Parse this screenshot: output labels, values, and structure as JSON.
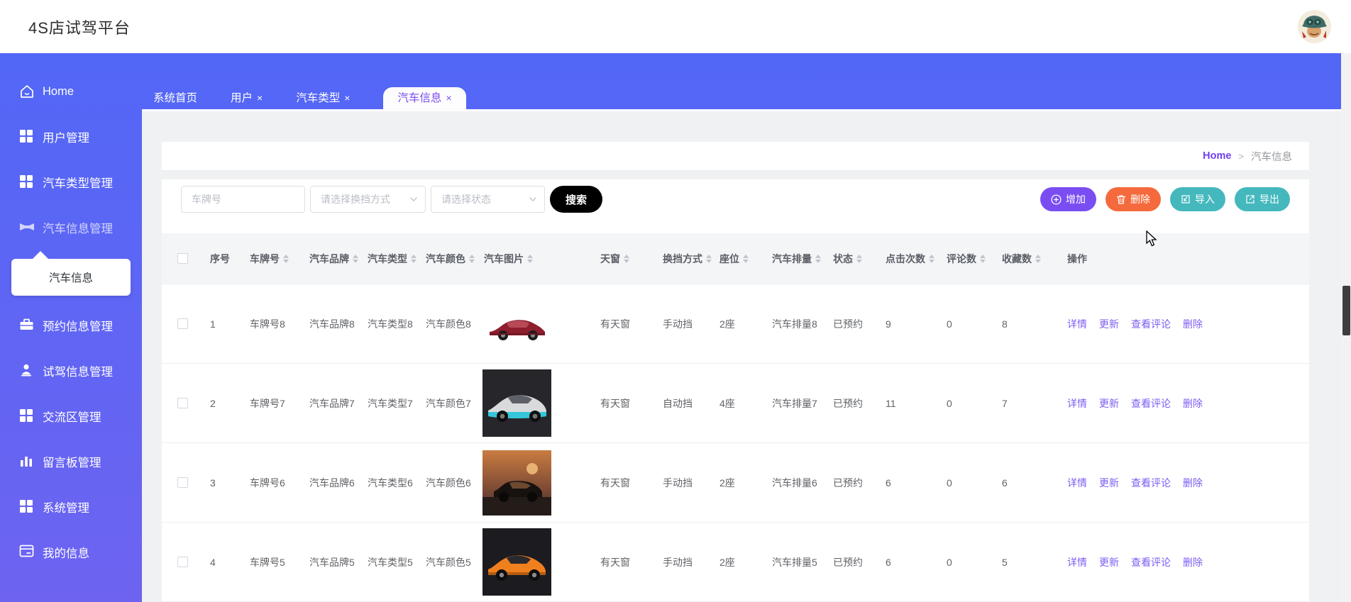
{
  "app": {
    "title": "4S店试驾平台"
  },
  "sidebar": {
    "items": [
      {
        "label": "Home",
        "icon": "home-icon",
        "active": false
      },
      {
        "label": "用户管理",
        "icon": "grid-icon",
        "active": false
      },
      {
        "label": "汽车类型管理",
        "icon": "grid-icon",
        "active": false
      },
      {
        "label": "汽车信息管理",
        "icon": "car-icon",
        "active": true
      },
      {
        "label": "预约信息管理",
        "icon": "briefcase-icon",
        "active": false
      },
      {
        "label": "试驾信息管理",
        "icon": "user-icon",
        "active": false
      },
      {
        "label": "交流区管理",
        "icon": "grid-icon",
        "active": false
      },
      {
        "label": "留言板管理",
        "icon": "bar-chart-icon",
        "active": false
      },
      {
        "label": "系统管理",
        "icon": "grid-icon",
        "active": false
      },
      {
        "label": "我的信息",
        "icon": "card-icon",
        "active": false
      }
    ],
    "submenu": {
      "label": "汽车信息"
    }
  },
  "tabs": [
    {
      "label": "系统首页",
      "closable": false,
      "active": false
    },
    {
      "label": "用户",
      "closable": true,
      "active": false
    },
    {
      "label": "汽车类型",
      "closable": true,
      "active": false
    },
    {
      "label": "汽车信息",
      "closable": true,
      "active": true
    }
  ],
  "breadcrumb": {
    "home": "Home",
    "separator": ">",
    "current": "汽车信息"
  },
  "search": {
    "plate_placeholder": "车牌号",
    "gear_placeholder": "请选择换挡方式",
    "status_placeholder": "请选择状态",
    "button": "搜索"
  },
  "actions": {
    "add": "增加",
    "delete": "删除",
    "import": "导入",
    "export": "导出"
  },
  "table": {
    "headers": [
      "序号",
      "车牌号",
      "汽车品牌",
      "汽车类型",
      "汽车颜色",
      "汽车图片",
      "天窗",
      "换挡方式",
      "座位",
      "汽车排量",
      "状态",
      "点击次数",
      "评论数",
      "收藏数",
      "操作"
    ],
    "row_actions": [
      "详情",
      "更新",
      "查看评论",
      "删除"
    ],
    "rows": [
      {
        "index": "1",
        "plate": "车牌号8",
        "brand": "汽车品牌8",
        "type": "汽车类型8",
        "color": "汽车颜色8",
        "image": "red-sedan",
        "sunroof": "有天窗",
        "gear": "手动挡",
        "seats": "2座",
        "displacement": "汽车排量8",
        "status": "已预约",
        "clicks": "9",
        "comments": "0",
        "favorites": "8"
      },
      {
        "index": "2",
        "plate": "车牌号7",
        "brand": "汽车品牌7",
        "type": "汽车类型7",
        "color": "汽车颜色7",
        "image": "silver-supercar",
        "sunroof": "有天窗",
        "gear": "自动挡",
        "seats": "4座",
        "displacement": "汽车排量7",
        "status": "已预约",
        "clicks": "11",
        "comments": "0",
        "favorites": "7"
      },
      {
        "index": "3",
        "plate": "车牌号6",
        "brand": "汽车品牌6",
        "type": "汽车类型6",
        "color": "汽车颜色6",
        "image": "suv-sunset",
        "sunroof": "有天窗",
        "gear": "手动挡",
        "seats": "2座",
        "displacement": "汽车排量6",
        "status": "已预约",
        "clicks": "6",
        "comments": "0",
        "favorites": "6"
      },
      {
        "index": "4",
        "plate": "车牌号5",
        "brand": "汽车品牌5",
        "type": "汽车类型5",
        "color": "汽车颜色5",
        "image": "orange-car",
        "sunroof": "有天窗",
        "gear": "手动挡",
        "seats": "2座",
        "displacement": "汽车排量5",
        "status": "已预约",
        "clicks": "6",
        "comments": "0",
        "favorites": "5"
      }
    ]
  },
  "colors": {
    "brand_blue_top": "#5267f6",
    "brand_blue_bottom": "#6e63f1",
    "accent_purple": "#7a4df3",
    "danger_orange": "#f56a3d",
    "teal": "#44b8bd",
    "link_purple": "#7e5cf3",
    "breadcrumb_home": "#6f3ff0",
    "search_button_bg": "#000000",
    "header_text": "#5a5e66",
    "body_text": "#606266"
  }
}
